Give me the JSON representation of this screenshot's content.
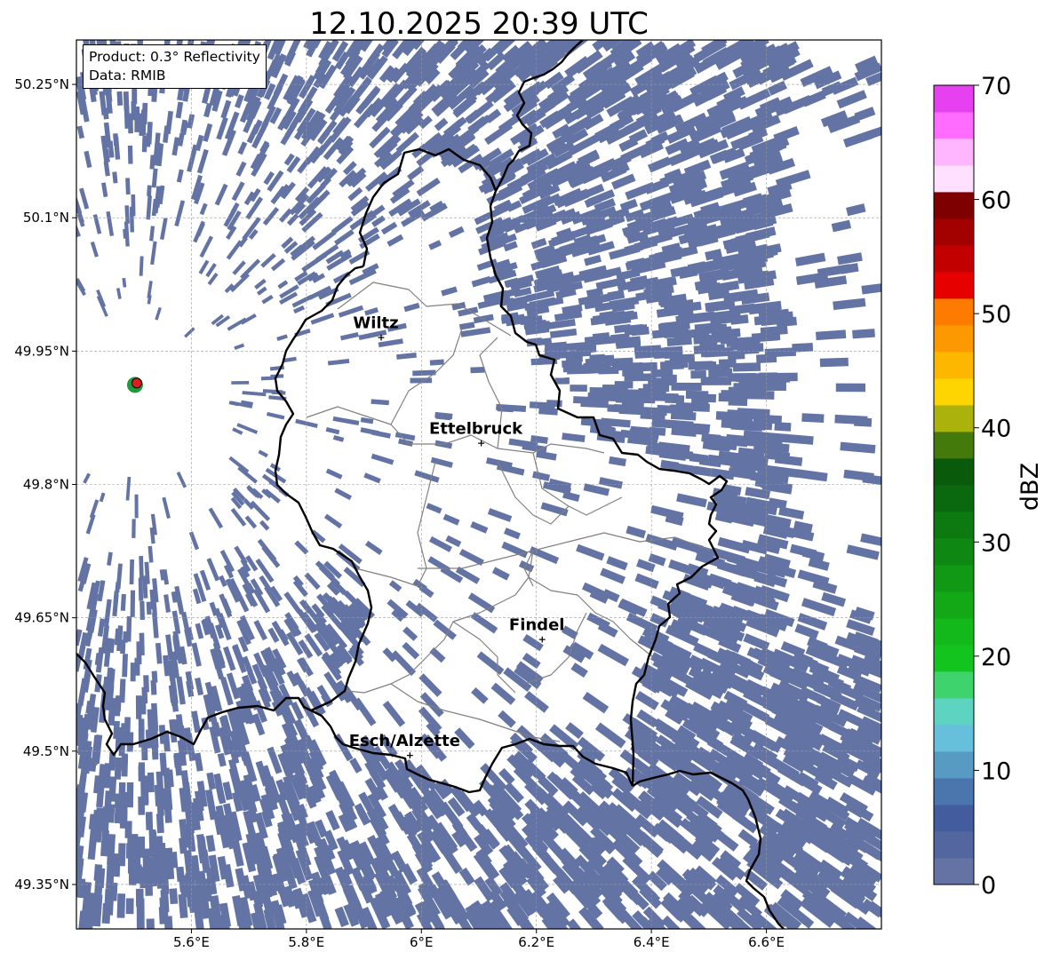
{
  "title": "12.10.2025 20:39 UTC",
  "info_box": {
    "product_line": "Product: 0.3° Reflectivity",
    "data_line": "Data: RMIB"
  },
  "axes": {
    "lon_range": [
      5.4,
      6.8
    ],
    "lat_range": [
      49.3,
      50.3
    ],
    "x_ticks": [
      {
        "value": 5.6,
        "label": "5.6°E"
      },
      {
        "value": 5.8,
        "label": "5.8°E"
      },
      {
        "value": 6.0,
        "label": "6°E"
      },
      {
        "value": 6.2,
        "label": "6.2°E"
      },
      {
        "value": 6.4,
        "label": "6.4°E"
      },
      {
        "value": 6.6,
        "label": "6.6°E"
      }
    ],
    "y_ticks": [
      {
        "value": 50.25,
        "label": "50.25°N"
      },
      {
        "value": 50.1,
        "label": "50.1°N"
      },
      {
        "value": 49.95,
        "label": "49.95°N"
      },
      {
        "value": 49.8,
        "label": "49.8°N"
      },
      {
        "value": 49.65,
        "label": "49.65°N"
      },
      {
        "value": 49.5,
        "label": "49.5°N"
      },
      {
        "value": 49.35,
        "label": "49.35°N"
      }
    ],
    "grid": true
  },
  "cities": [
    {
      "name": "Wiltz",
      "lon": 5.93,
      "lat": 49.966
    },
    {
      "name": "Ettelbruck",
      "lon": 6.104,
      "lat": 49.847
    },
    {
      "name": "Findel",
      "lon": 6.21,
      "lat": 49.626
    },
    {
      "name": "Esch/Alzette",
      "lon": 5.98,
      "lat": 49.496
    }
  ],
  "radar_site": {
    "lon": 5.505,
    "lat": 49.914
  },
  "colorbar": {
    "label": "dBZ",
    "min": 0,
    "max": 70,
    "step_dbz": 2.5,
    "tick_labels": [
      "0",
      "10",
      "20",
      "30",
      "40",
      "50",
      "60",
      "70"
    ],
    "colors": [
      "#6473a3",
      "#54669f",
      "#435c9e",
      "#4a76ad",
      "#589bc2",
      "#66bfdb",
      "#5dd3c1",
      "#3fd36d",
      "#14c41e",
      "#13b81a",
      "#12a816",
      "#119815",
      "#0e8813",
      "#0c7a10",
      "#0a690e",
      "#0a5a0c",
      "#447a0c",
      "#acb20c",
      "#fed500",
      "#fdb700",
      "#fc9900",
      "#fd7b00",
      "#e60000",
      "#c30000",
      "#a30000",
      "#7f0000",
      "#ffe0ff",
      "#ffb6ff",
      "#ff6cff",
      "#e740f0"
    ]
  },
  "field_color": "#6373a4",
  "border_color": "#000000",
  "canton_color": "#808080"
}
